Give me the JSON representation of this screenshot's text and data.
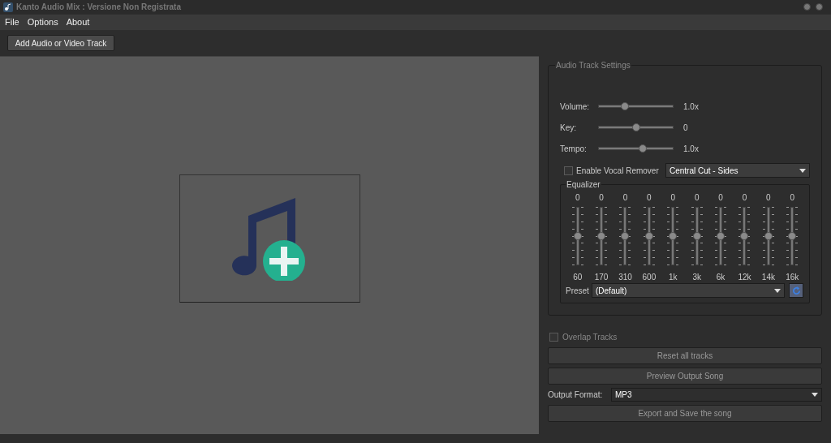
{
  "window": {
    "title": "Kanto Audio Mix : Versione Non Registrata"
  },
  "menu": [
    "File",
    "Options",
    "About"
  ],
  "toolbar": {
    "add_button": "Add Audio or Video Track"
  },
  "settings": {
    "title": "Audio Track Settings",
    "sliders": [
      {
        "label": "Volume:",
        "level": 0.35,
        "reading": "1.0x"
      },
      {
        "label": "Key:",
        "level": 0.5,
        "reading": "0"
      },
      {
        "label": "Tempo:",
        "level": 0.59,
        "reading": "1.0x"
      }
    ],
    "vocal_remover": {
      "label": "Enable Vocal Remover",
      "checked": false,
      "mode": "Central Cut - Sides"
    },
    "equalizer": {
      "title": "Equalizer",
      "bands": [
        {
          "value": "0",
          "freq": "60",
          "level": 0.5
        },
        {
          "value": "0",
          "freq": "170",
          "level": 0.5
        },
        {
          "value": "0",
          "freq": "310",
          "level": 0.5
        },
        {
          "value": "0",
          "freq": "600",
          "level": 0.5
        },
        {
          "value": "0",
          "freq": "1k",
          "level": 0.5
        },
        {
          "value": "0",
          "freq": "3k",
          "level": 0.5
        },
        {
          "value": "0",
          "freq": "6k",
          "level": 0.5
        },
        {
          "value": "0",
          "freq": "12k",
          "level": 0.5
        },
        {
          "value": "0",
          "freq": "14k",
          "level": 0.5
        },
        {
          "value": "0",
          "freq": "16k",
          "level": 0.5
        }
      ],
      "preset_label": "Preset",
      "preset": "(Default)"
    }
  },
  "overlap": {
    "label": "Overlap Tracks",
    "checked": false
  },
  "reset_button": "Reset all tracks",
  "preview_button": "Preview Output Song",
  "output_format": {
    "label": "Output Format:",
    "value": "MP3"
  },
  "export_button": "Export and Save the song"
}
